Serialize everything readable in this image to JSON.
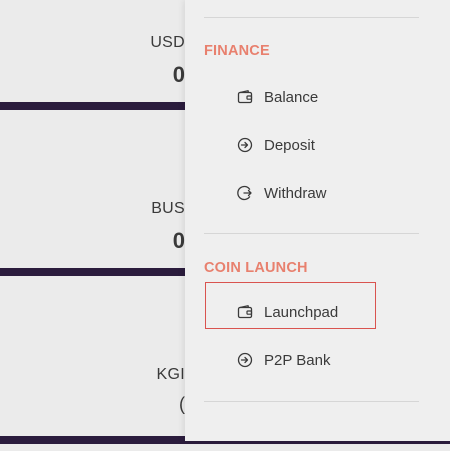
{
  "background_cards": [
    {
      "code": "USD",
      "value": "0"
    },
    {
      "code": "BUS",
      "value": "0"
    },
    {
      "code": "KGI",
      "value": "("
    }
  ],
  "menu": {
    "sections": [
      {
        "title": "FINANCE",
        "items": [
          {
            "label": "Balance",
            "icon": "wallet-icon"
          },
          {
            "label": "Deposit",
            "icon": "arrow-in-circle-icon"
          },
          {
            "label": "Withdraw",
            "icon": "arrow-out-circle-icon"
          }
        ]
      },
      {
        "title": "COIN LAUNCH",
        "items": [
          {
            "label": "Launchpad",
            "icon": "wallet-icon",
            "highlighted": true
          },
          {
            "label": "P2P Bank",
            "icon": "arrow-in-circle-icon"
          }
        ]
      }
    ]
  },
  "colors": {
    "accent": "#e8806e",
    "highlight_border": "#d9534f",
    "bar": "#2b1c3d"
  }
}
